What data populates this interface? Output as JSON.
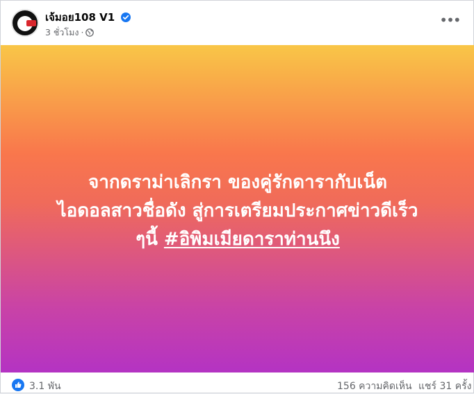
{
  "post": {
    "author": "เจ้มอย108 V1",
    "time": "3 ชั่วโมง",
    "separator": "·",
    "privacy_icon": "globe-icon",
    "more_icon": "more-options-icon",
    "banner": {
      "lines": [
        "จากดราม่าเลิกรา ของคู่รักดารากับเน็ต",
        "ไอดอลสาวชื่อดัง สู่การเตรียมประกาศข่าวดีเร็ว"
      ],
      "line3_prefix": "ๆนี้ ",
      "hashtag": "#อิพิมเมียดาราท่านนึง",
      "gradient_colors": [
        "#f9c647",
        "#f9774c",
        "#c943a6",
        "#b433c3"
      ]
    },
    "reactions": {
      "icon": "like-icon",
      "count": "3.1 พัน",
      "color": "#1877f2"
    },
    "comments": "156 ความคิดเห็น",
    "shares": "แชร์ 31 ครั้ง"
  }
}
